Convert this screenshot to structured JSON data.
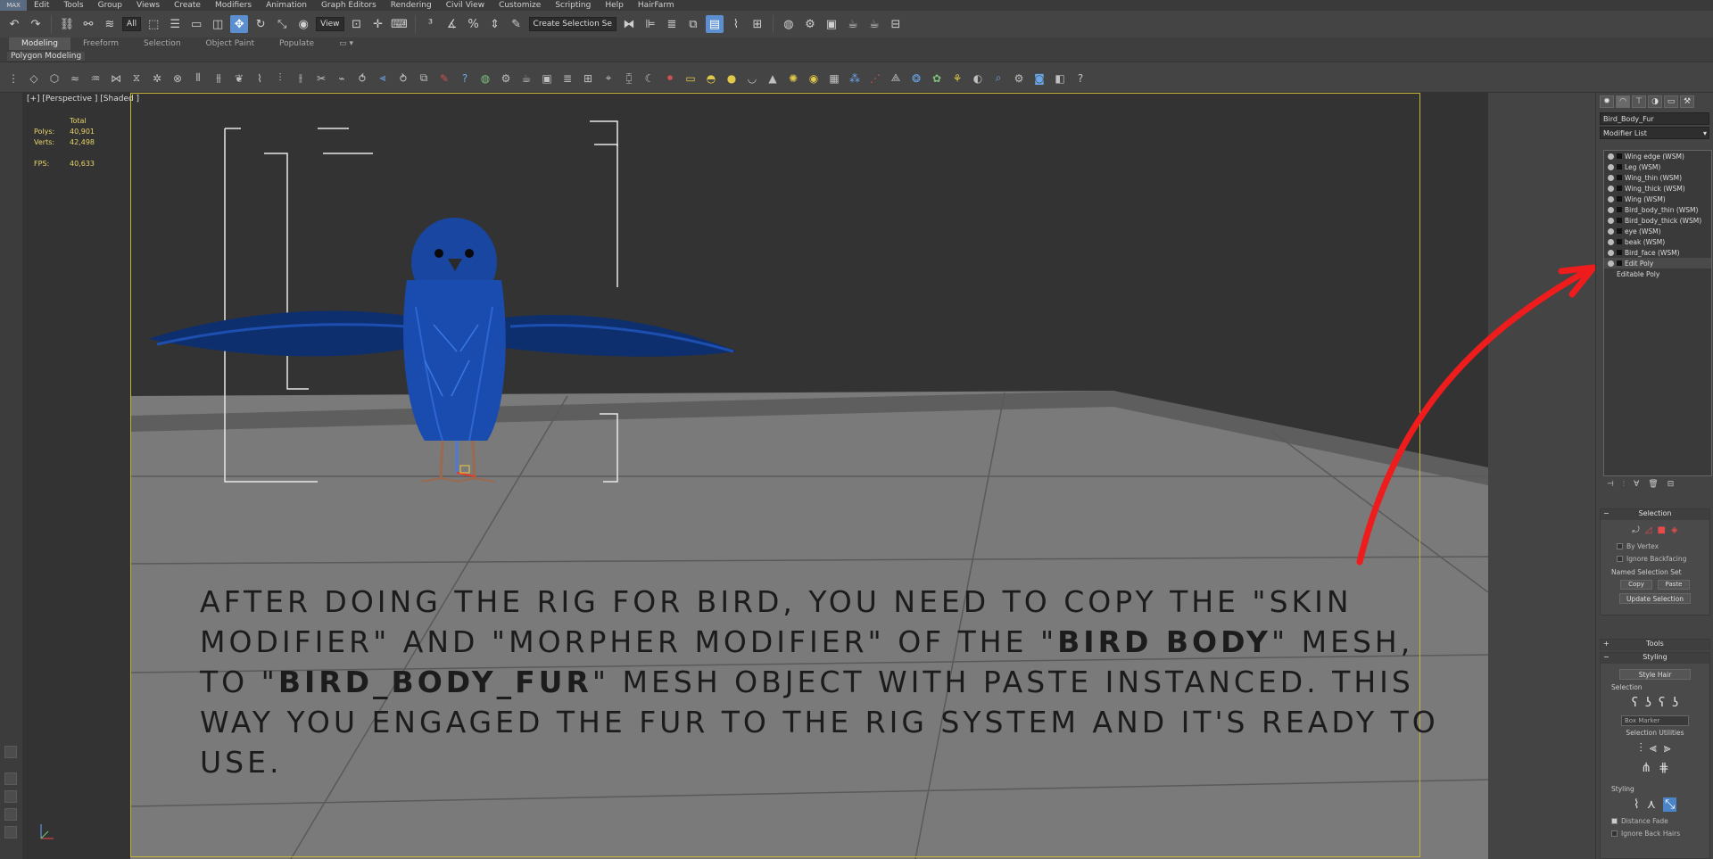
{
  "menu": {
    "logo": "MAX",
    "items": [
      "Edit",
      "Tools",
      "Group",
      "Views",
      "Create",
      "Modifiers",
      "Animation",
      "Graph Editors",
      "Rendering",
      "Civil View",
      "Customize",
      "Scripting",
      "Help",
      "HairFarm"
    ]
  },
  "toolbar": {
    "filter_value": "All",
    "view_value": "View",
    "selection_set_placeholder": "Create Selection Se"
  },
  "ribbon": {
    "tabs": [
      "Modeling",
      "Freeform",
      "Selection",
      "Object Paint",
      "Populate"
    ],
    "active_tab": "Modeling",
    "sub_label": "Polygon Modeling"
  },
  "viewport": {
    "label": "[+] [Perspective ] [Shaded ]",
    "stats": {
      "header": "Total",
      "polys_label": "Polys:",
      "polys_value": "40,901",
      "verts_label": "Verts:",
      "verts_value": "42,498",
      "fps_label": "FPS:",
      "fps_value": "40,633"
    },
    "caption": {
      "part1": "AFTER DOING THE RIG FOR BIRD, YOU NEED TO COPY THE \"SKIN MODIFIER\" AND \"MORPHER MODIFIER\" OF THE \"",
      "bold1": "BIRD BODY",
      "part2": "\" MESH, TO \"",
      "bold2": "BIRD_BODY_FUR",
      "part3": "\" MESH OBJECT WITH PASTE INSTANCED. THIS WAY YOU ENGAGED THE FUR TO THE RIG SYSTEM AND IT'S READY TO USE."
    }
  },
  "command_panel": {
    "object_name": "Bird_Body_Fur",
    "modifier_list_label": "Modifier List",
    "modifiers": [
      "Wing edge (WSM)",
      "Leg (WSM)",
      "Wing_thin (WSM)",
      "Wing_thick (WSM)",
      "Wing (WSM)",
      "Bird_body_thin (WSM)",
      "Bird_body_thick (WSM)",
      "eye (WSM)",
      "beak (WSM)",
      "Bird_face (WSM)",
      "Edit Poly"
    ],
    "base_object": "Editable Poly",
    "selection_rollout": {
      "title": "Selection",
      "by_vertex": "By Vertex",
      "ignore_backfacing": "Ignore Backfacing",
      "named_selection_set": "Named Selection Set",
      "copy": "Copy",
      "paste": "Paste",
      "update_selection": "Update Selection"
    },
    "tools_rollout": {
      "title": "Tools"
    },
    "styling_rollout": {
      "title": "Styling",
      "style_hair": "Style Hair",
      "selection_label": "Selection",
      "box_marker": "Box Marker",
      "selection_utilities": "Selection Utilities",
      "styling_label": "Styling",
      "distance_fade": "Distance Fade",
      "ignore_back_hairs": "Ignore Back Hairs"
    }
  },
  "colors": {
    "viewport_bg": "#333333",
    "active_frame": "#c8b43a",
    "stats_text": "#e8d36a",
    "annotation_arrow": "#ee1c1c",
    "accent": "#5b8fd0"
  }
}
